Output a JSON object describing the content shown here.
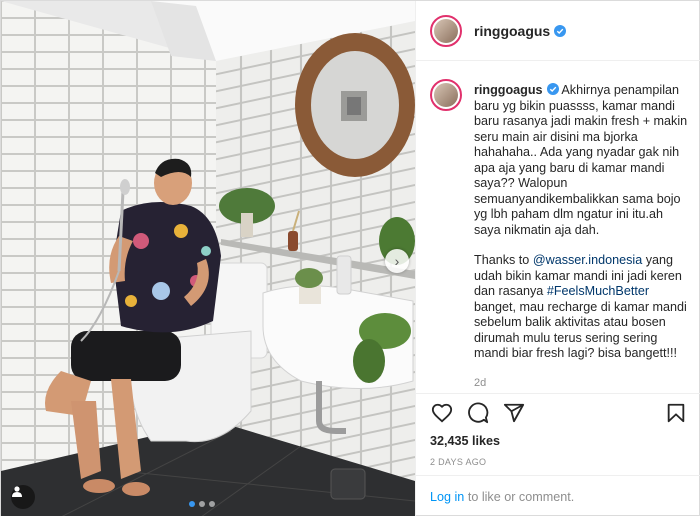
{
  "post": {
    "username": "ringgoagus",
    "verified": true,
    "caption": {
      "paragraph1": "Akhirnya penampilan baru yg bikin puassss, kamar mandi baru rasanya jadi makin fresh + makin seru main air disini ma bjorka hahahaha.. Ada yang nyadar gak nih apa aja yang baru di kamar mandi saya?? Walopun semuanyandikembalikkan sama bojo yg lbh paham dlm ngatur ini itu.ah saya nikmatin aja dah.",
      "p2_before": "Thanks to ",
      "p2_mention": "@wasser.indonesia",
      "p2_middle": " yang udah bikin kamar mandi ini jadi keren dan rasanya ",
      "p2_hashtag": "#FeelsMuchBetter",
      "p2_after": " banget, mau recharge di kamar mandi sebelum balik aktivitas atau bosen dirumah mulu terus sering sering mandi biar fresh lagi? bisa bangett!!!"
    },
    "caption_age": "2d",
    "likes": "32,435 likes",
    "date": "2 DAYS AGO",
    "login_link": "Log in",
    "login_rest": " to like or comment.",
    "carousel": {
      "slides": 3,
      "active": 0
    }
  },
  "icons": {
    "like": "heart-icon",
    "comment": "comment-icon",
    "share": "share-icon",
    "save": "bookmark-icon",
    "verified": "verified-badge-icon",
    "tags": "user-tag-icon",
    "next": "chevron-right-icon"
  },
  "colors": {
    "link": "#00376b",
    "login": "#0095f6",
    "verified": "#3897f0",
    "muted": "#8e8e8e",
    "text": "#262626"
  }
}
